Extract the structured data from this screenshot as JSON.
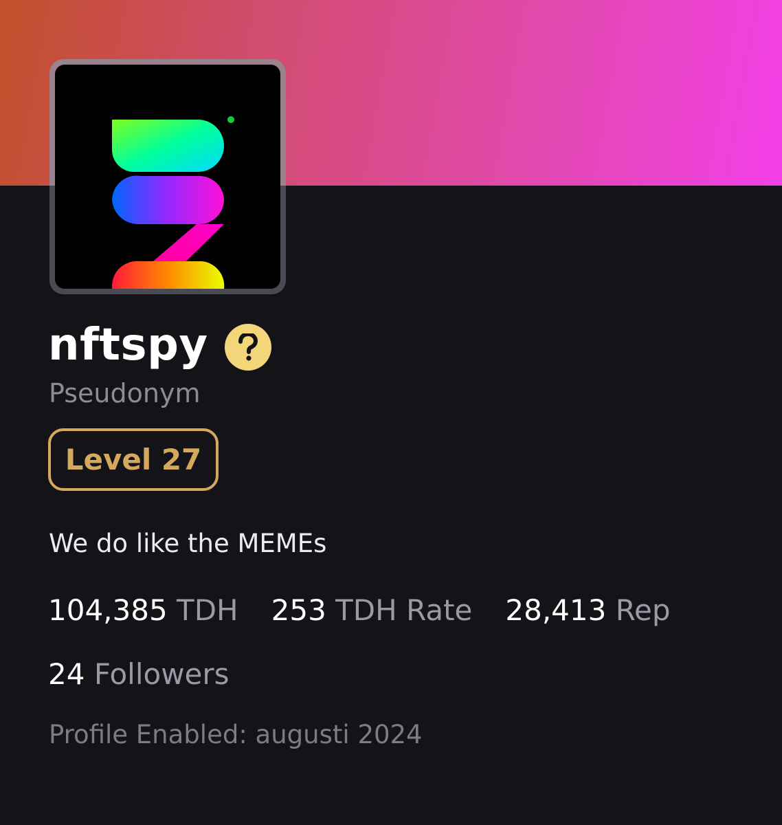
{
  "profile": {
    "username": "nftspy",
    "classification": "Pseudonym",
    "level": "Level 27",
    "bio": "We do like the MEMEs",
    "stats": [
      {
        "value": "104,385",
        "label": "TDH"
      },
      {
        "value": "253",
        "label": "TDH Rate"
      },
      {
        "value": "28,413",
        "label": "Rep"
      }
    ],
    "followers": {
      "value": "24",
      "label": "Followers"
    },
    "profile_enabled": "Profile Enabled: augusti 2024"
  },
  "icons": {
    "help": "question-mark-circle-icon",
    "verified": "verified-check-icon"
  },
  "colors": {
    "background": "#131318",
    "banner_start": "#c2502a",
    "banner_end": "#f23fe8",
    "level_accent": "#d4a95e",
    "help_badge": "#f3d57a"
  }
}
